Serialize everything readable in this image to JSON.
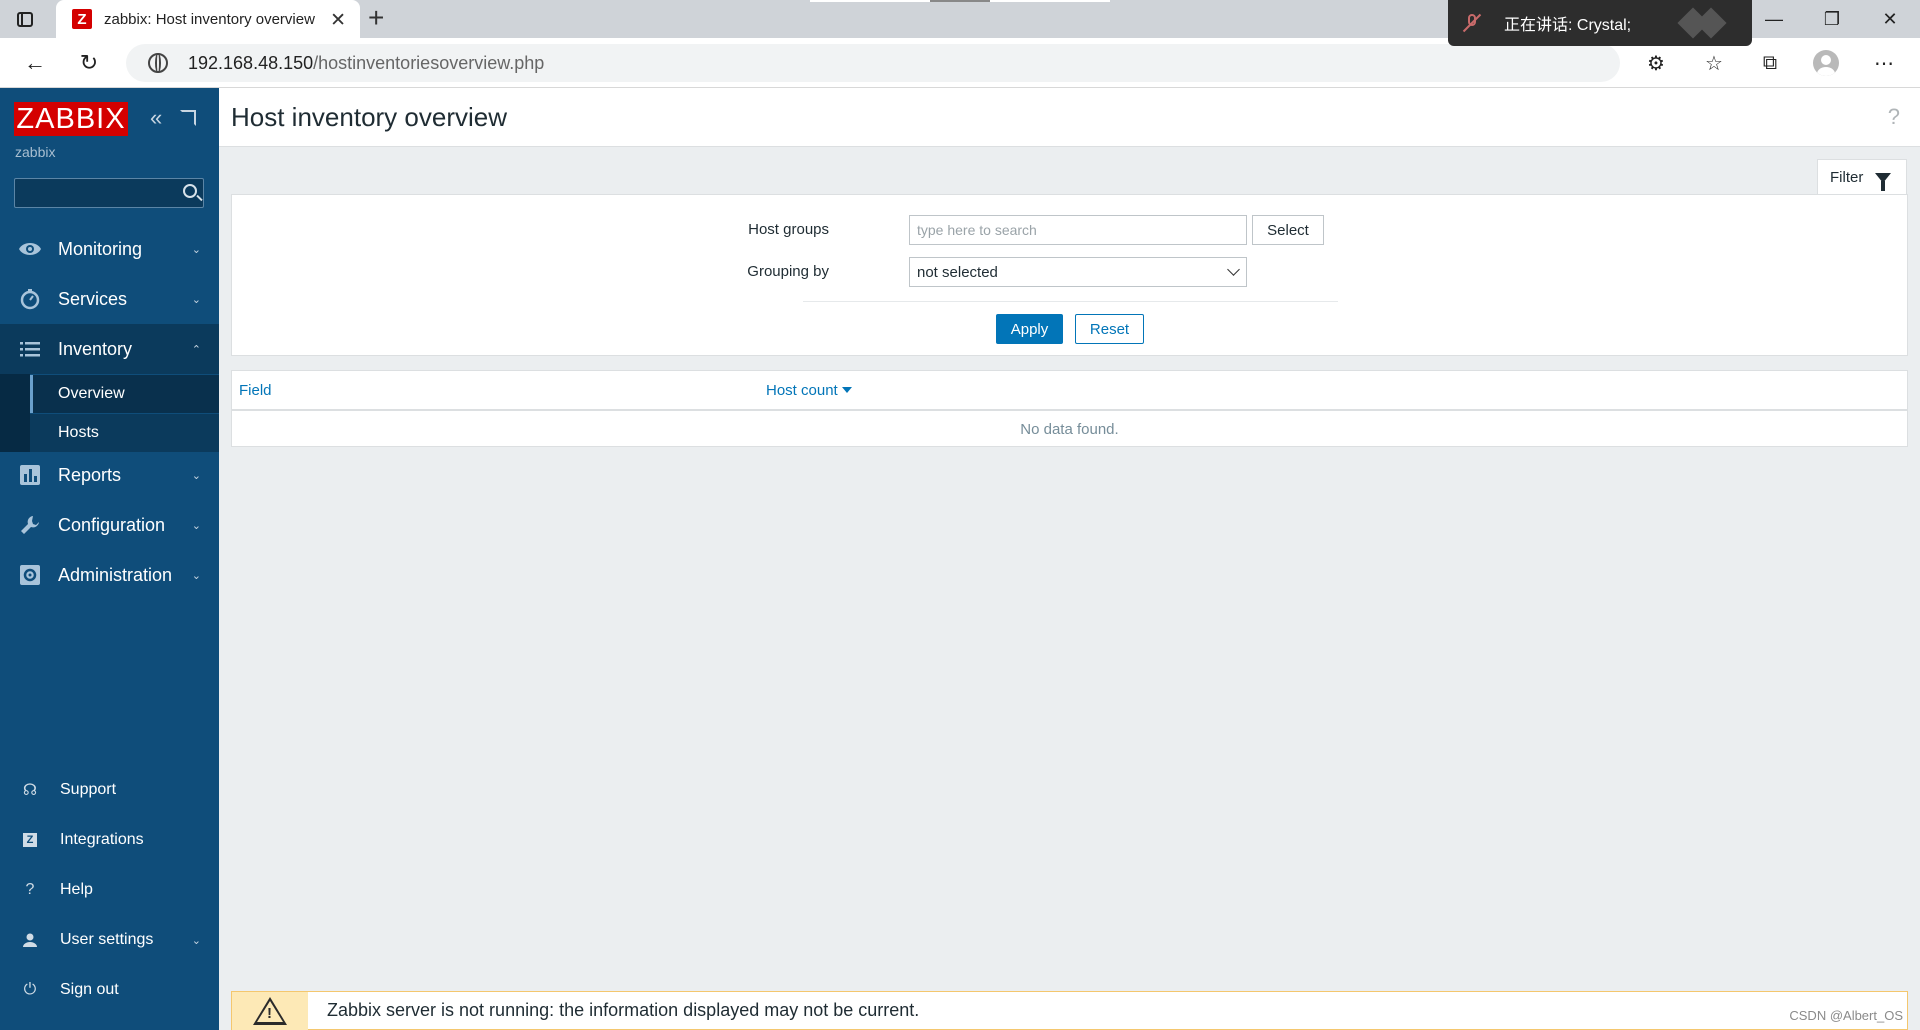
{
  "browser": {
    "tab_title": "zabbix: Host inventory overview",
    "tab_favicon_letter": "Z",
    "url_host": "192.168.48.150",
    "url_path": "/hostinventoriesoverview.php",
    "speaking_label": "正在讲话: Crystal;"
  },
  "sidebar": {
    "logo": "ZABBIX",
    "server_name": "zabbix",
    "menu": [
      {
        "label": "Monitoring",
        "icon": "eye-icon"
      },
      {
        "label": "Services",
        "icon": "stopwatch-icon"
      },
      {
        "label": "Inventory",
        "icon": "list-icon"
      },
      {
        "label": "Reports",
        "icon": "bar-chart-icon"
      },
      {
        "label": "Configuration",
        "icon": "wrench-icon"
      },
      {
        "label": "Administration",
        "icon": "gear-icon"
      }
    ],
    "inventory_sub": [
      {
        "label": "Overview"
      },
      {
        "label": "Hosts"
      }
    ],
    "bottom": [
      {
        "label": "Support",
        "icon": "headset-icon"
      },
      {
        "label": "Integrations",
        "icon": "zabbix-z-icon"
      },
      {
        "label": "Help",
        "icon": "question-icon"
      },
      {
        "label": "User settings",
        "icon": "user-icon"
      },
      {
        "label": "Sign out",
        "icon": "power-icon"
      }
    ]
  },
  "main": {
    "title": "Host inventory overview",
    "filter_tab_label": "Filter",
    "filter": {
      "host_groups_label": "Host groups",
      "host_groups_placeholder": "type here to search",
      "select_button": "Select",
      "grouping_label": "Grouping by",
      "grouping_value": "not selected",
      "apply": "Apply",
      "reset": "Reset"
    },
    "table": {
      "columns": [
        "Field",
        "Host count"
      ],
      "empty_text": "No data found."
    },
    "warning": "Zabbix server is not running: the information displayed may not be current.",
    "watermark": "CSDN @Albert_OS"
  },
  "colors": {
    "sidebar": "#0f4d7a",
    "accent": "#0275b8",
    "logo_red": "#d40000",
    "warning_bg": "#fde9b6"
  }
}
